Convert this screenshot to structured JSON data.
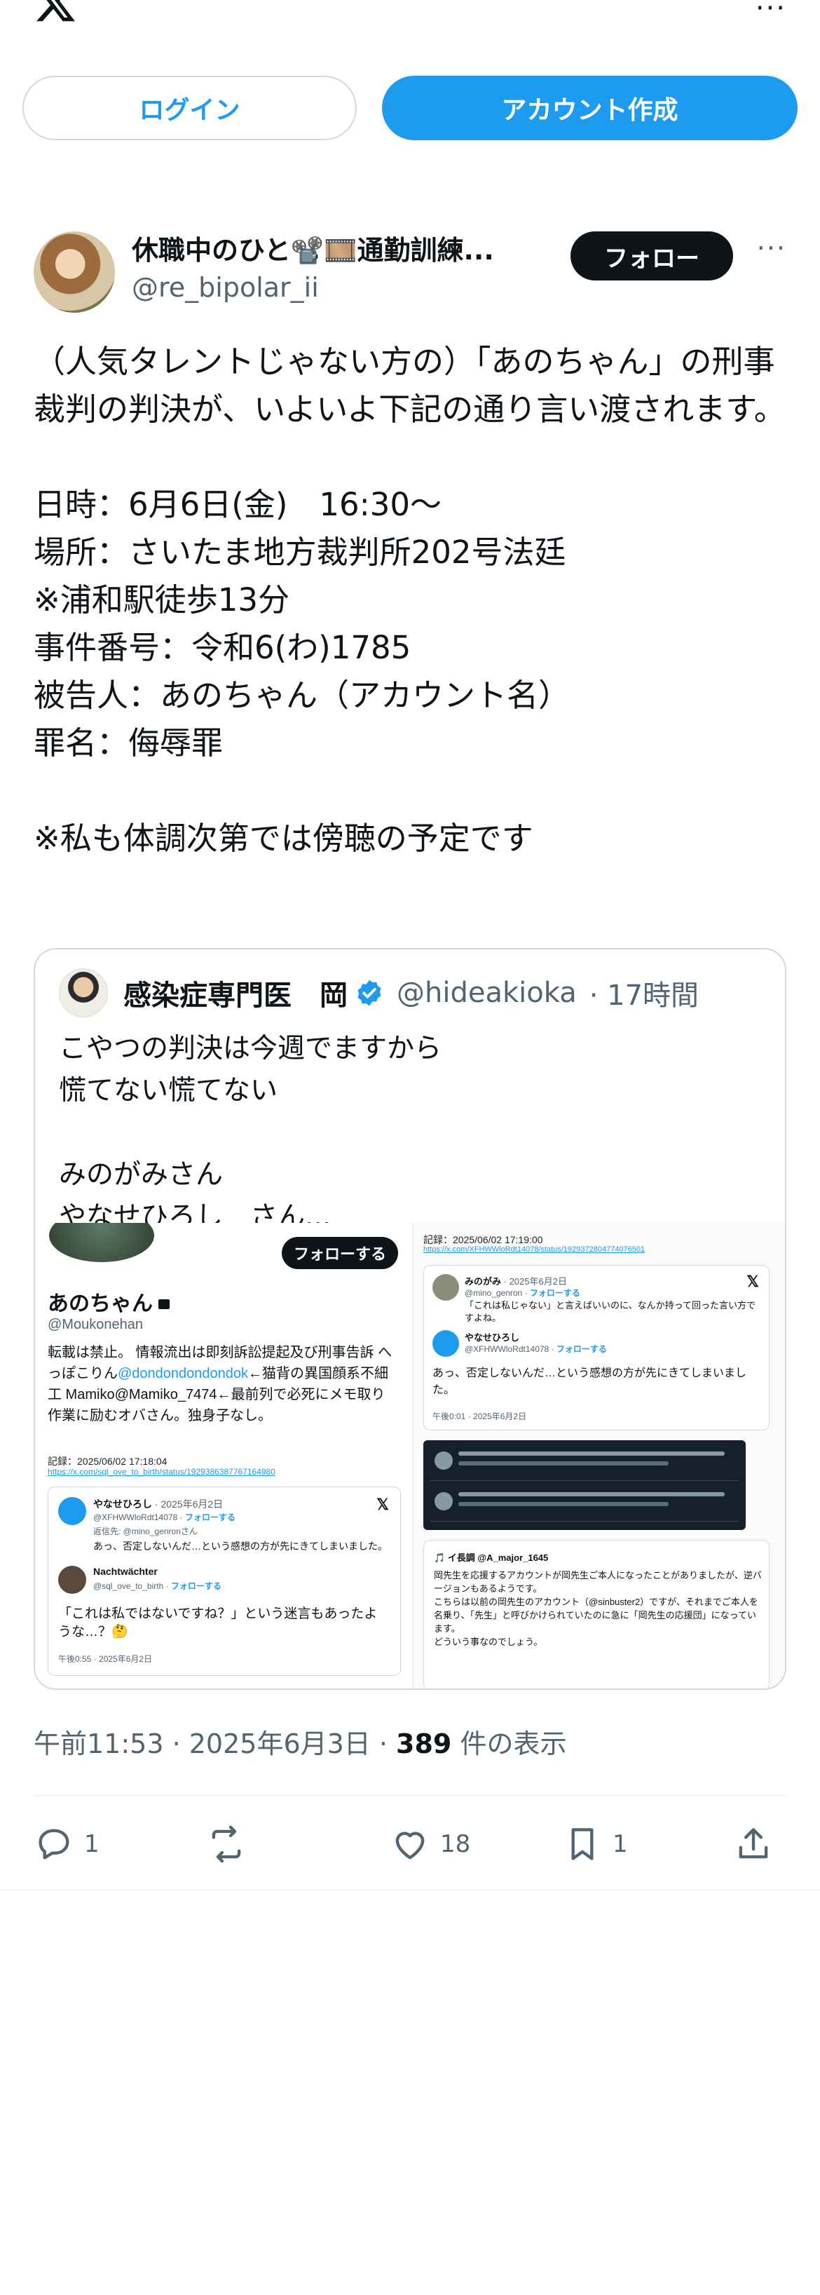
{
  "header": {
    "logo_icon": "x-logo-icon",
    "more_icon": "more-icon"
  },
  "auth": {
    "login_label": "ログイン",
    "signup_label": "アカウント作成"
  },
  "post": {
    "author_name": "休職中のひと📽️🎞️通勤訓練...",
    "author_handle": "@re_bipolar_ii",
    "follow_label": "フォロー",
    "more_label": "···",
    "text": "（人気タレントじゃない方の）「あのちゃん」の刑事裁判の判決が、いよいよ下記の通り言い渡されます。\n\n日時：6月6日(金)　16:30〜\n場所：さいたま地方裁判所202号法廷\n※浦和駅徒歩13分\n事件番号：令和6(わ)1785\n被告人：あのちゃん（アカウント名）\n罪名：侮辱罪\n\n※私も体調次第では傍聴の予定です"
  },
  "quote": {
    "author_name": "感染症専門医　岡",
    "author_handle": "@hideakioka",
    "time": "· 17時間",
    "text": "こやつの判決は今週でますから\n慌てない慌てない\n\nみのがみさん\nやなせひろし　さん...",
    "media_left": {
      "follow_label": "フォローする",
      "name": "あのちゃん",
      "handle": "@Moukonehan",
      "bio_a": "転載は禁止。 情報流出は即刻訴訟提起及び刑事告訴 へっぽこりん",
      "bio_link": "@dondondondondok",
      "bio_b": "←猫背の異国顔系不細工 Mamiko@Mamiko_7474←最前列で必死にメモ取り作業に励むオバさん。独身子なし。",
      "record": "記録：2025/06/02 17:18:04",
      "record_url": "https://x.com/sql_ove_to_birth/status/1929386387767164980",
      "c1_name": "やなせひろし",
      "c1_date": "· 2025年6月2日",
      "c1_handle": "@XFHWWloRdt14078",
      "follow_small": "フォローする",
      "c1_reply": "返信先: @mino_genronさん",
      "c1_text": "あっ、否定しないんだ…という感想の方が先にきてしまいました。",
      "c2_name": "Nachtwächter",
      "c2_handle": "@sql_ove_to_birth",
      "c2_text": "「これは私ではないですね？」という迷言もあったような…？🤔",
      "c2_time": "午後0:55 · 2025年6月2日"
    },
    "media_right": {
      "record": "記録：2025/06/02 17:19:00",
      "record_url": "https://x.com/XFHWWloRdt14078/status/1929372804774076501",
      "c1_name": "みのがみ",
      "c1_date": "· 2025年6月2日",
      "c1_handle": "@mino_genron",
      "follow_small": "フォローする",
      "c1_text": "「これは私じゃない」と言えばいいのに、なんか持って回った言い方ですよね。",
      "c2_name": "やなせひろし",
      "c2_handle": "@XFHWWloRdt14078",
      "c2_text": "あっ、否定しないんだ…という感想の方が先にきてしまいました。",
      "c2_time": "午後0:01 · 2025年6月2日",
      "c3_name": "🎵 イ長調 @A_major_1645",
      "c3_text": "岡先生を応援するアカウントが岡先生ご本人になったことがありましたが、逆バージョンもあるようです。\nこちらは以前の岡先生のアカウント（@sinbuster2）ですが、それまでご本人を名乗り、「先生」と呼びかけられていたのに急に「岡先生の応援団」になっています。\nどういう事なのでしょう。"
    }
  },
  "meta": {
    "time": "午前11:53 · 2025年6月3日 · ",
    "views_num": "389",
    "views_label": " 件の表示"
  },
  "actions": {
    "replies": "1",
    "reposts": "",
    "likes": "18",
    "bookmarks": "1"
  },
  "colors": {
    "accent": "#1d9bf0",
    "text": "#0f1419",
    "muted": "#536471",
    "border": "#cfd9de"
  }
}
